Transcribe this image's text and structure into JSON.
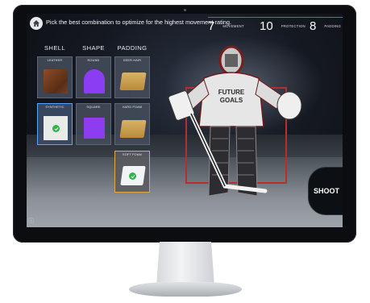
{
  "header": {
    "instruction": "Pick the best combination to optimize for the highest movement rating.",
    "stats": [
      {
        "value": "7",
        "label": "MOVEMENT"
      },
      {
        "value": "10",
        "label": "PROTECTION"
      },
      {
        "value": "8",
        "label": "PADDING"
      }
    ]
  },
  "columns": {
    "shell": {
      "header": "SHELL",
      "options": [
        {
          "label": "LEATHER",
          "selected": false
        },
        {
          "label": "SYNTHETIC",
          "selected": true
        }
      ]
    },
    "shape": {
      "header": "SHAPE",
      "options": [
        {
          "label": "ROUND",
          "selected": false
        },
        {
          "label": "SQUARE",
          "selected": false
        }
      ]
    },
    "padding": {
      "header": "PADDING",
      "options": [
        {
          "label": "DEER HAIR",
          "selected": false
        },
        {
          "label": "HARD FOAM",
          "selected": false
        },
        {
          "label": "SOFT FOAM",
          "selected": true
        }
      ]
    }
  },
  "jersey": {
    "line1": "FUTURE",
    "line2": "GOALS"
  },
  "actions": {
    "shoot_label": "SHOOT"
  },
  "colors": {
    "accent": "#3c6ef0",
    "selected_check": "#2bb84a",
    "shape_purple": "#8a3df2",
    "pad_tan": "#d8b267"
  }
}
